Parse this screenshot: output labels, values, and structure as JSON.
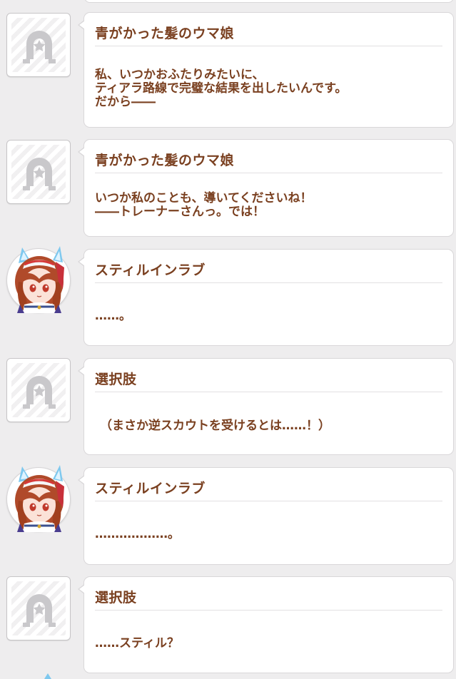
{
  "colors": {
    "background": "#eeedee",
    "bubble": "#ffffff",
    "text": "#7a4020",
    "divider": "#e2e0e2"
  },
  "entries": [
    {
      "speaker": "青がかった髪のウマ娘",
      "avatar": "horseshoe-placeholder-icon",
      "lines": [
        "私、いつかおふたりみたいに、",
        "ティアラ路線で完璧な結果を出したいんです。",
        "だから――"
      ]
    },
    {
      "speaker": "青がかった髪のウマ娘",
      "avatar": "horseshoe-placeholder-icon",
      "lines": [
        "いつか私のことも、導いてくださいね！",
        "――トレーナーさんっ。では！"
      ]
    },
    {
      "speaker": "スティルインラブ",
      "avatar": "still-in-love-portrait",
      "lines": [
        "……。"
      ]
    },
    {
      "speaker": "選択肢",
      "avatar": "horseshoe-placeholder-icon",
      "lines": [
        "（まさか逆スカウトを受けるとは……！）"
      ]
    },
    {
      "speaker": "スティルインラブ",
      "avatar": "still-in-love-portrait",
      "lines": [
        "………………。"
      ]
    },
    {
      "speaker": "選択肢",
      "avatar": "horseshoe-placeholder-icon",
      "lines": [
        "……スティル？"
      ]
    }
  ]
}
